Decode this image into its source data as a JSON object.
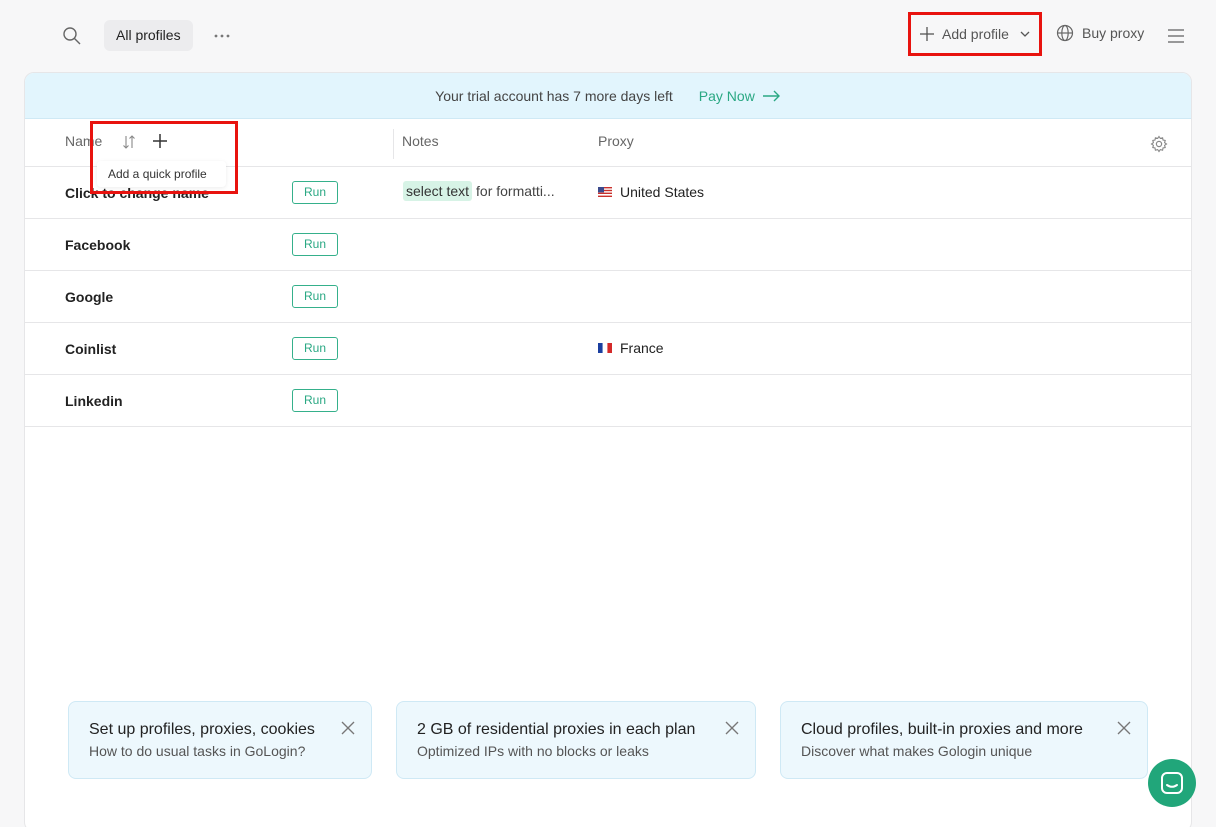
{
  "topbar": {
    "tab_label": "All profiles",
    "add_profile_label": "Add profile",
    "buy_proxy_label": "Buy proxy"
  },
  "banner": {
    "text": "Your trial account has 7 more days left",
    "link": "Pay Now"
  },
  "table": {
    "headers": {
      "name": "Name",
      "notes": "Notes",
      "proxy": "Proxy"
    },
    "tooltip": "Add a quick profile",
    "run_label": "Run",
    "rows": [
      {
        "name": "Click to change name",
        "note_highlight": "select text",
        "note_rest": "for formatti...",
        "proxy": "United States"
      },
      {
        "name": "Facebook",
        "note_highlight": "",
        "note_rest": "",
        "proxy": ""
      },
      {
        "name": "Google",
        "note_highlight": "",
        "note_rest": "",
        "proxy": ""
      },
      {
        "name": "Coinlist",
        "note_highlight": "",
        "note_rest": "",
        "proxy": "France"
      },
      {
        "name": "Linkedin",
        "note_highlight": "",
        "note_rest": "",
        "proxy": ""
      }
    ]
  },
  "info_cards": [
    {
      "title": "Set up profiles, proxies, cookies",
      "subtitle": "How to do usual tasks in GoLogin?"
    },
    {
      "title": "2 GB of residential proxies in each plan",
      "subtitle": "Optimized IPs with no blocks or leaks"
    },
    {
      "title": "Cloud profiles, built-in proxies and more",
      "subtitle": "Discover what makes Gologin unique"
    }
  ],
  "colors": {
    "accent": "#2aa883",
    "banner_bg": "#e2f5fd",
    "highlight_box": "#e8130f"
  }
}
